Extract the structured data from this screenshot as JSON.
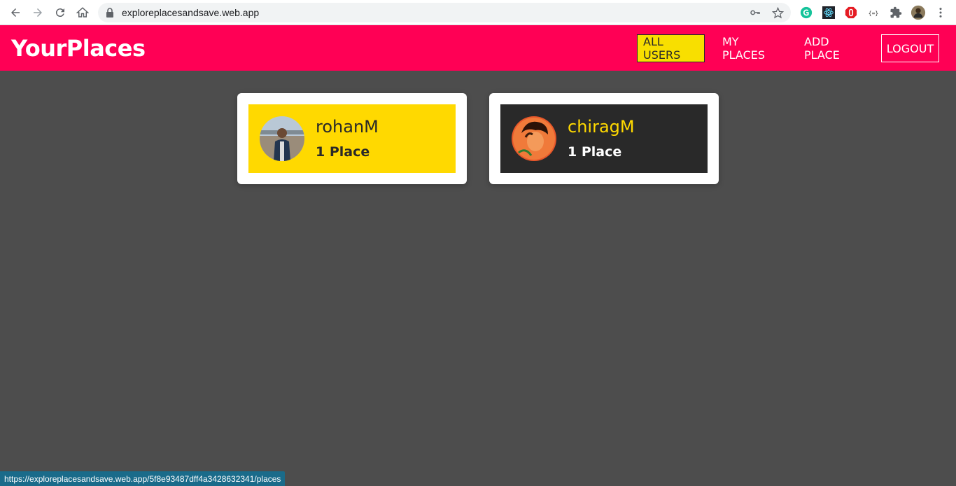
{
  "browser": {
    "url": "exploreplacesandsave.web.app",
    "status_url": "https://exploreplacesandsave.web.app/5f8e93487dff4a3428632341/places"
  },
  "header": {
    "logo": "YourPlaces",
    "nav": [
      {
        "label": "ALL USERS",
        "active": true
      },
      {
        "label": "MY PLACES",
        "active": false
      },
      {
        "label": "ADD PLACE",
        "active": false
      },
      {
        "label": "LOGOUT",
        "active": false
      }
    ]
  },
  "users": [
    {
      "name": "rohanM",
      "places": "1 Place"
    },
    {
      "name": "chiragM",
      "places": "1 Place"
    }
  ],
  "colors": {
    "header_bg": "#ff0055",
    "page_bg": "#4d4d4d",
    "accent_yellow": "#ffd900",
    "dark": "#292929"
  }
}
